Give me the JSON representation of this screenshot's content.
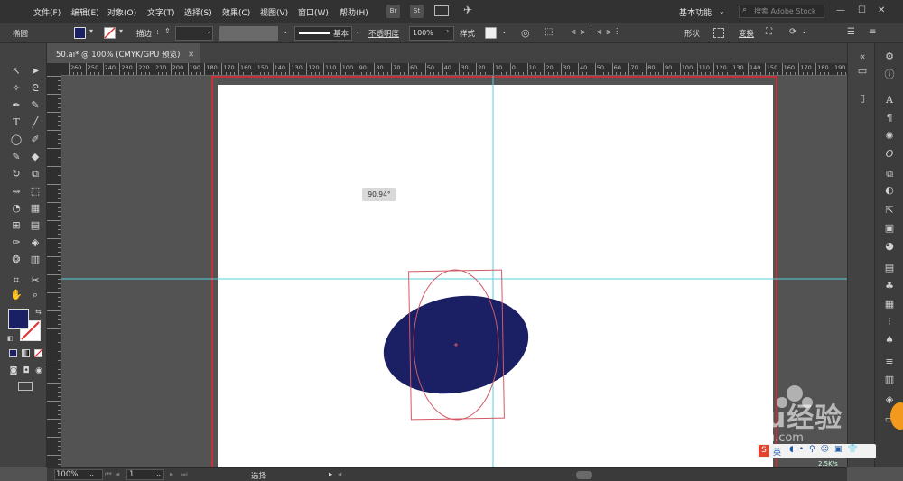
{
  "menu": {
    "items": [
      "文件(F)",
      "编辑(E)",
      "对象(O)",
      "文字(T)",
      "选择(S)",
      "效果(C)",
      "视图(V)",
      "窗口(W)",
      "帮助(H)"
    ],
    "app_icons": [
      "Br",
      "St"
    ],
    "workspace": "基本功能",
    "stock_placeholder": "搜索 Adobe Stock"
  },
  "controlbar": {
    "selection_label": "椭圆",
    "stroke_label": "描边",
    "stroke_style": "基本",
    "opacity_label": "不透明度",
    "opacity_value": "100%",
    "style_label": "样式",
    "shape_label": "形状",
    "transform_label": "变换"
  },
  "document": {
    "tab_title": "50.ai* @ 100% (CMYK/GPU 预览)",
    "rotation_tooltip": "90.94°"
  },
  "ruler": {
    "h_labels": [
      "260",
      "250",
      "240",
      "230",
      "220",
      "210",
      "200",
      "190",
      "180",
      "170",
      "160",
      "150",
      "140",
      "130",
      "120",
      "110",
      "100",
      "90",
      "80",
      "70",
      "60",
      "50",
      "40",
      "30",
      "20",
      "10",
      "0",
      "10",
      "20",
      "30",
      "40",
      "50",
      "60",
      "70",
      "80",
      "90",
      "100",
      "110",
      "120",
      "130",
      "140",
      "150",
      "160",
      "170",
      "180",
      "190"
    ]
  },
  "status": {
    "zoom": "100%",
    "artboard": "1",
    "tool": "选择"
  },
  "colors": {
    "fill": "#1b1f63",
    "guide": "#55d0dd",
    "bbox": "#d25a66",
    "artboard_border": "#c6303a"
  },
  "watermark": {
    "brand": "Baidu经验",
    "url": "jingyan.baidu.com",
    "net_speed": "2.5K/s"
  }
}
